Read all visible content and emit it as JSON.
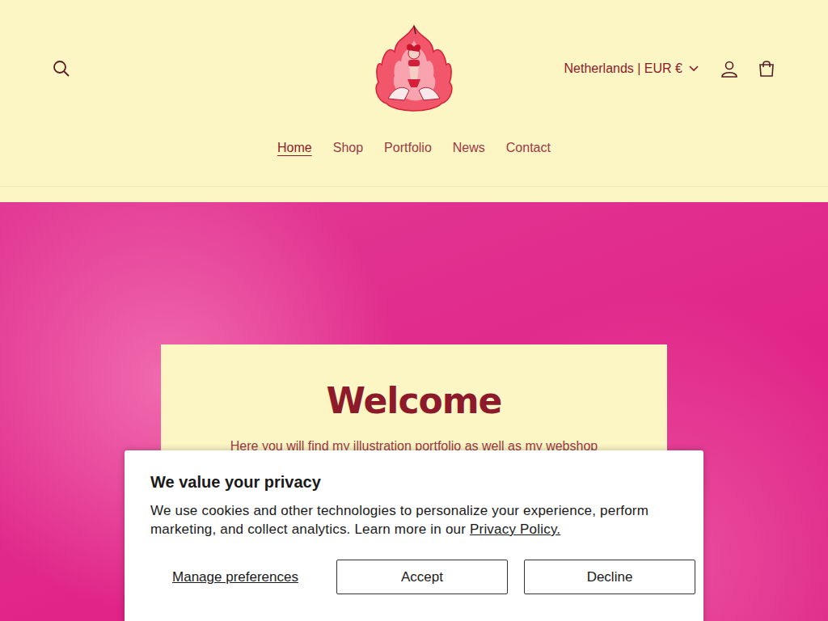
{
  "header": {
    "country_selector": "Netherlands | EUR €"
  },
  "nav": [
    {
      "label": "Home",
      "selected": true
    },
    {
      "label": "Shop",
      "selected": false
    },
    {
      "label": "Portfolio",
      "selected": false
    },
    {
      "label": "News",
      "selected": false
    },
    {
      "label": "Contact",
      "selected": false
    }
  ],
  "hero": {
    "title": "Welcome",
    "text": "Here you will find my illustration portfolio as well as my webshop"
  },
  "cookie_banner": {
    "title": "We value your privacy",
    "text": "We use cookies and other technologies to personalize your experience, perform marketing, and collect analytics. Learn more in our",
    "link": "Privacy Policy.",
    "buttons": [
      {
        "label": "Manage preferences",
        "kind": "link"
      },
      {
        "label": "Accept",
        "kind": "outline"
      },
      {
        "label": "Decline",
        "kind": "outline"
      }
    ]
  }
}
